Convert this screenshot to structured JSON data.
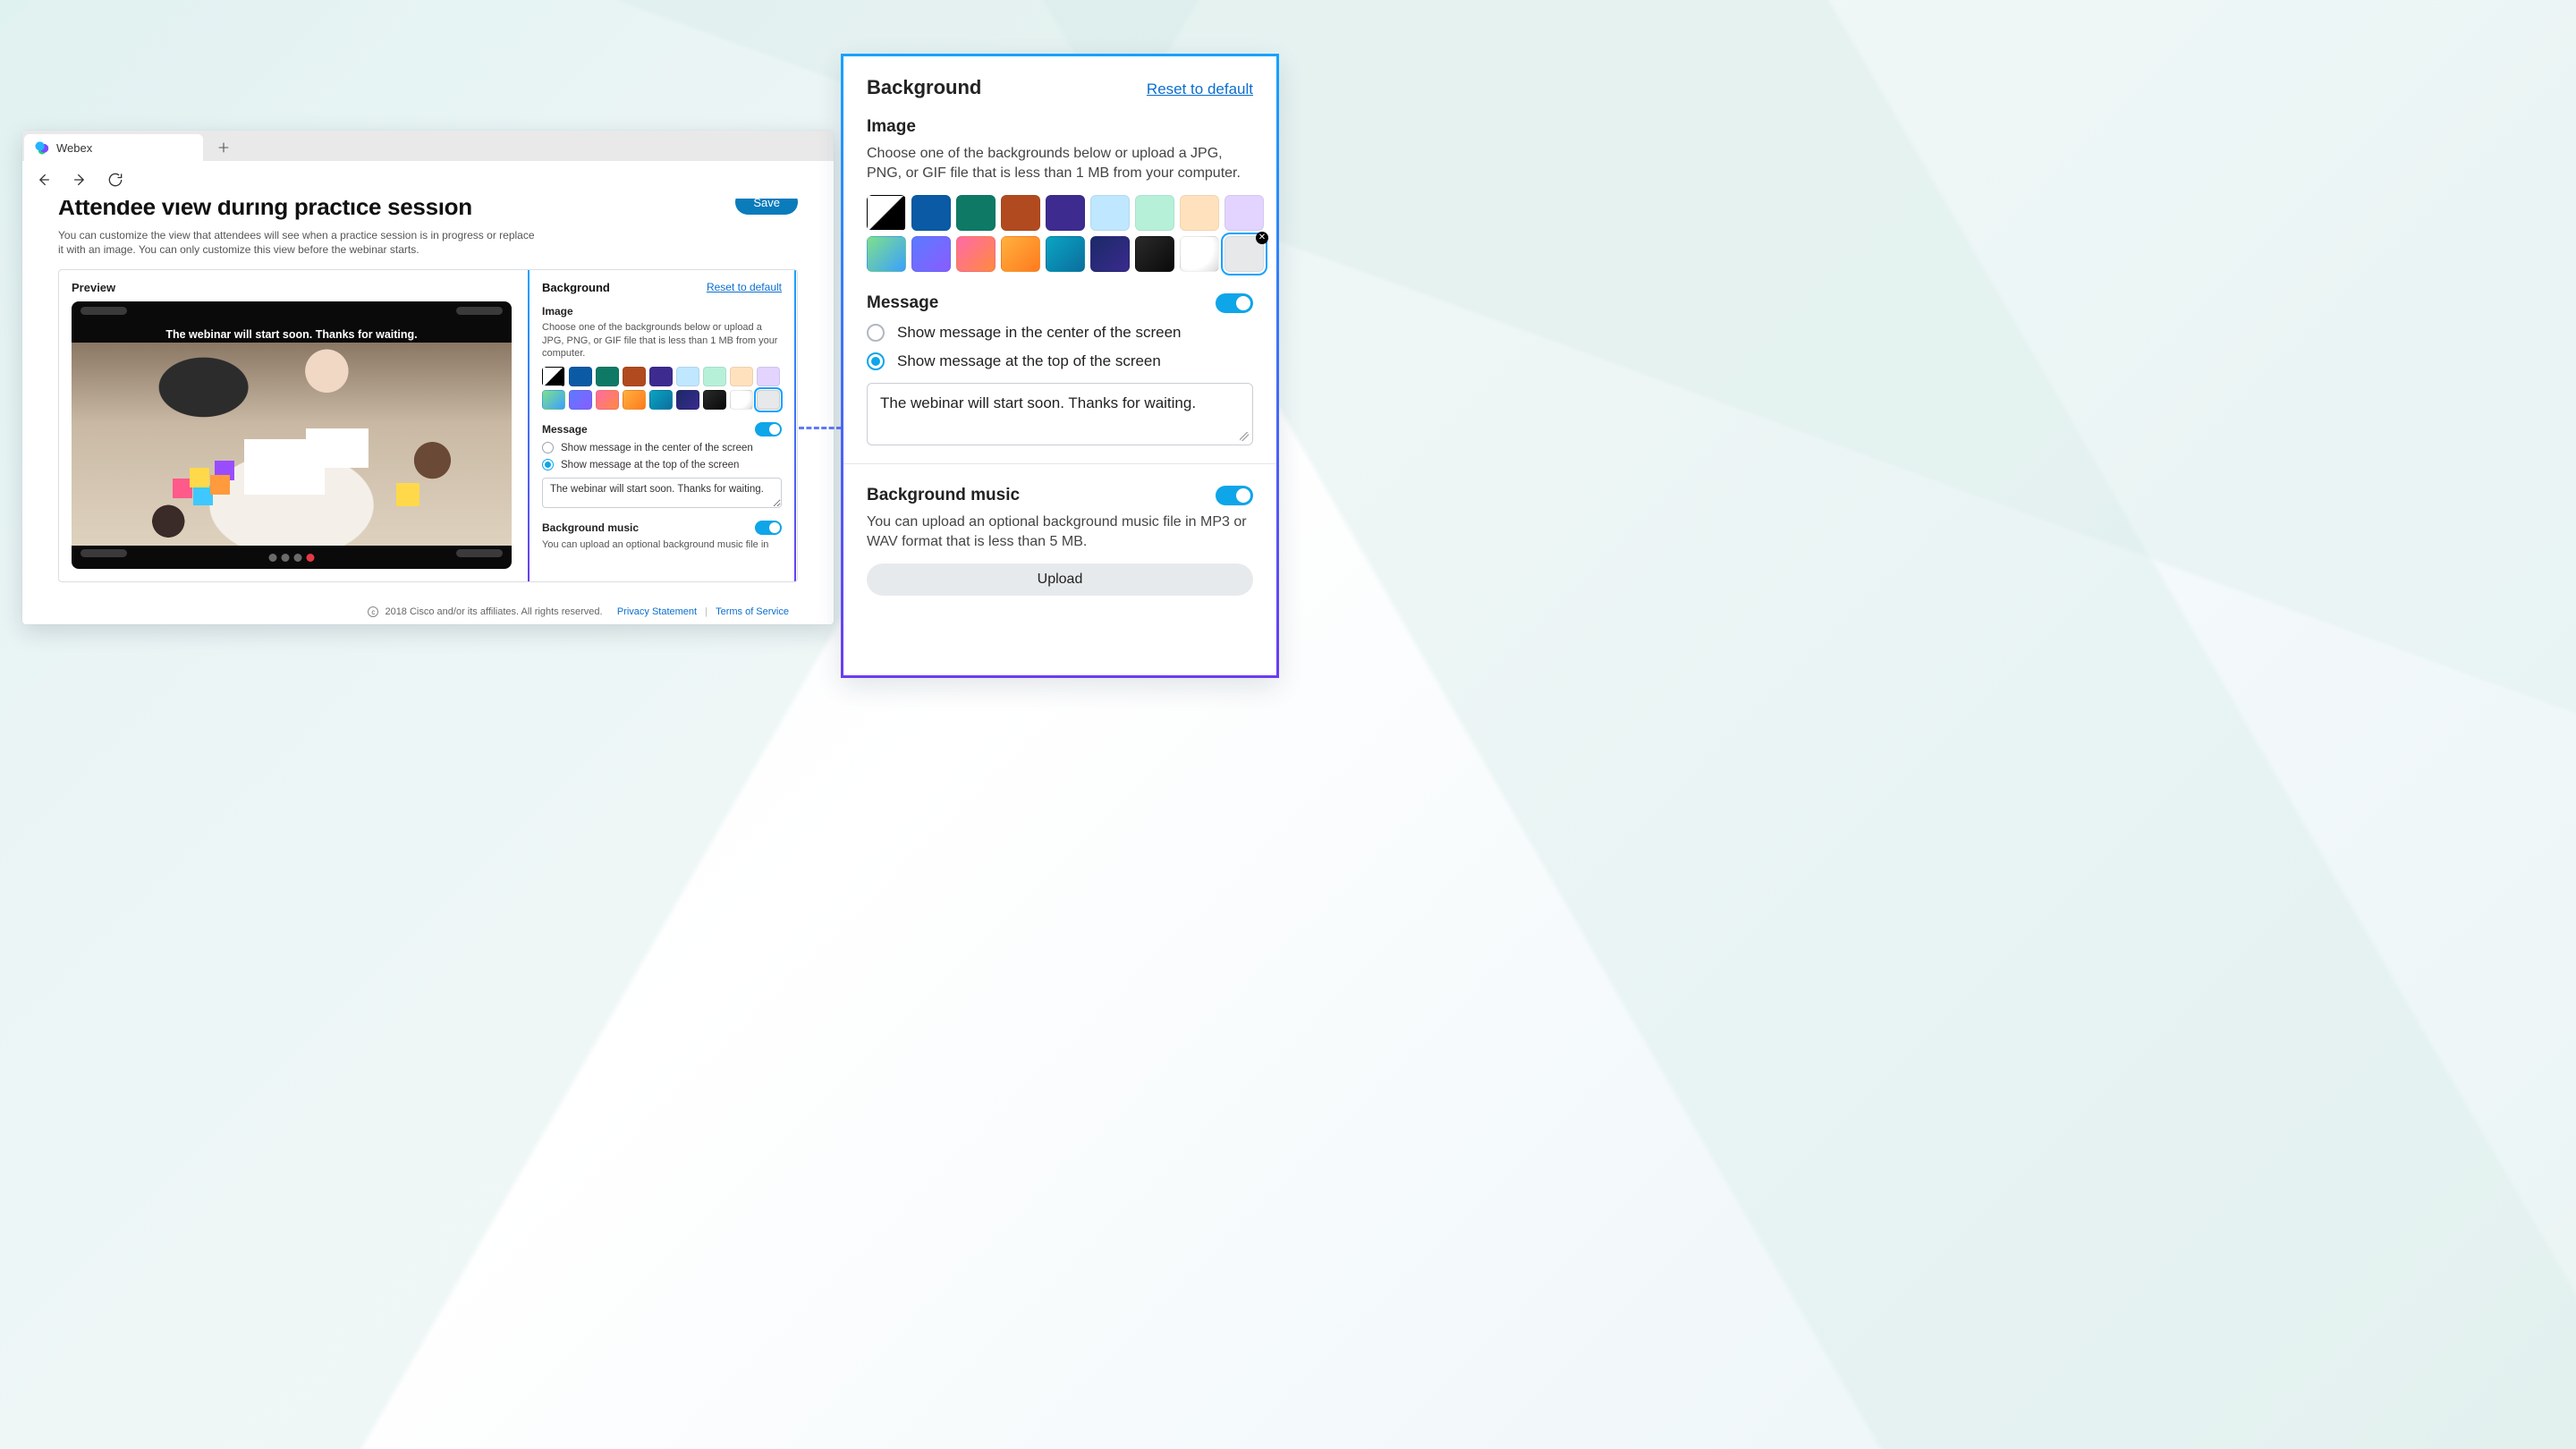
{
  "browser": {
    "tab_title": "Webex"
  },
  "page": {
    "title": "Attendee view during practice session",
    "subtitle": "You can customize the view that attendees will see when a practice session is in progress or replace it with an image. You can only customize this view before the webinar starts.",
    "save_label": "Save",
    "preview_label": "Preview",
    "preview_message": "The webinar will start soon. Thanks for waiting."
  },
  "footer": {
    "copyright": "2018 Cisco and/or its affiliates. All rights reserved.",
    "privacy_label": "Privacy Statement",
    "terms_label": "Terms of Service"
  },
  "panel": {
    "title": "Background",
    "reset_label": "Reset to default",
    "image_section": "Image",
    "image_desc": "Choose one of the backgrounds below or upload a JPG, PNG, or GIF file that is less than 1 MB from your computer.",
    "message_section": "Message",
    "msg_opt_center": "Show message in the center of the screen",
    "msg_opt_top": "Show message at the top of the screen",
    "msg_value": "The webinar will start soon. Thanks for waiting.",
    "music_section": "Background music",
    "music_desc_short": "You can upload an optional background music file in",
    "music_desc_full": "You can upload an optional background music file in MP3 or WAV format that is less than 5 MB.",
    "upload_label": "Upload"
  },
  "swatches": {
    "colors": [
      "diag",
      "#0a5aa5",
      "#0e7a66",
      "#b24a1f",
      "#3d2b8f",
      "#bfe7ff",
      "#b7f0d9",
      "#ffe2bd",
      "#e3d4ff",
      "linear-gradient(135deg,#7fe08a,#3aa0ff)",
      "linear-gradient(135deg,#5a7bff,#8a5cff)",
      "linear-gradient(135deg,#ff6aa9,#ff8a3d)",
      "linear-gradient(135deg,#ffb13d,#ff7a1f)",
      "linear-gradient(135deg,#0aa5c2,#0b6e9e)",
      "linear-gradient(135deg,#1b2a66,#3a2a8f)",
      "linear-gradient(135deg,#2a2a2a,#0a0a0a)",
      "radial-gradient(circle at 30% 30%, #fff 0 60%, #d8d8d8 100%)",
      "#e6e8ea"
    ],
    "selected_index": 17
  }
}
